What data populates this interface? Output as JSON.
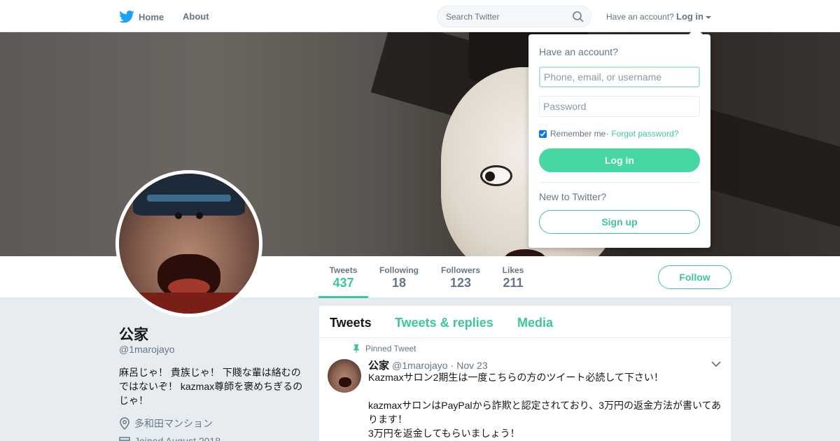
{
  "nav": {
    "home_label": "Home",
    "about_label": "About",
    "search_placeholder": "Search Twitter",
    "have_account": "Have an account?",
    "login_label": "Log in"
  },
  "profile": {
    "name": "公家",
    "handle": "@1marojayo",
    "bio": "麻呂じゃ！ 貴族じゃ！ 下賤な輩は絡むのではないぞ！ kazmax尊師を褒めちぎるのじゃ！",
    "location": "多和田マンション",
    "joined": "Joined August 2018"
  },
  "stats": [
    {
      "label": "Tweets",
      "value": "437"
    },
    {
      "label": "Following",
      "value": "18"
    },
    {
      "label": "Followers",
      "value": "123"
    },
    {
      "label": "Likes",
      "value": "211"
    }
  ],
  "follow_label": "Follow",
  "timeline": {
    "tabs": [
      "Tweets",
      "Tweets & replies",
      "Media"
    ],
    "pinned_label": "Pinned Tweet",
    "tweet": {
      "name": "公家",
      "handle": "@1marojayo",
      "sep": "·",
      "time": "Nov 23",
      "lines": [
        "Kazmaxサロン2期生は一度こちらの方のツイート必読して下さい！",
        "",
        "kazmaxサロンはPayPalから詐欺と認定されており、3万円の返金方法が書いてあります！",
        "3万円を返金してもらいましょう！"
      ]
    }
  },
  "login_dropdown": {
    "title": "Have an account?",
    "username_placeholder": "Phone, email, or username",
    "password_placeholder": "Password",
    "remember_label": "Remember me",
    "sep": " · ",
    "forgot_label": "Forgot password?",
    "login_button": "Log in",
    "new_label": "New to Twitter?",
    "signup_button": "Sign up"
  },
  "colors": {
    "accent": "#3cc69c",
    "login_button": "#45d8a3",
    "twitter_blue": "#1da1f2"
  }
}
